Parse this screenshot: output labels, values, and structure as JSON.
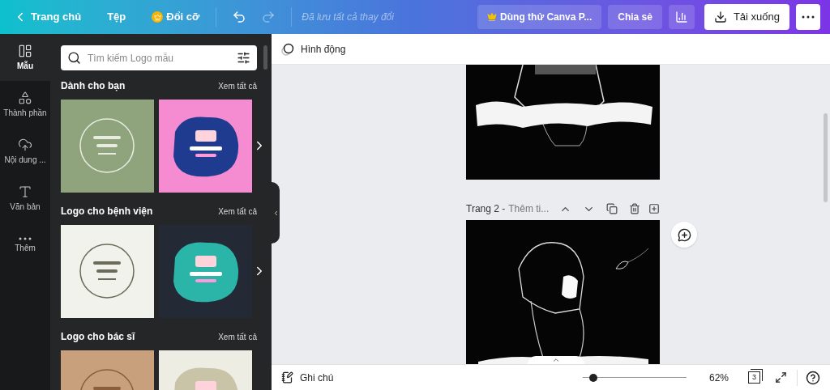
{
  "topbar": {
    "back": "Trang chủ",
    "file_menu": "Tệp",
    "resize": "Đổi cỡ",
    "save_status": "Đã lưu tất cả thay đổi",
    "try_pro": "Dùng thử Canva P...",
    "share": "Chia sẻ",
    "download": "Tải xuống"
  },
  "rail": [
    {
      "kind": "templates",
      "label": "Mẫu",
      "selected": true
    },
    {
      "kind": "elements",
      "label": "Thành phần",
      "selected": false
    },
    {
      "kind": "uploads",
      "label": "Nội dung ...",
      "selected": false
    },
    {
      "kind": "text",
      "label": "Văn bản",
      "selected": false
    },
    {
      "kind": "more",
      "label": "Thêm",
      "selected": false
    }
  ],
  "panel": {
    "search": {
      "placeholder": "Tìm kiếm Logo mẫu"
    },
    "sections": [
      {
        "title": "Dành cho bạn",
        "see_all": "Xem tất cả"
      },
      {
        "title": "Logo cho bệnh viện",
        "see_all": "Xem tất cả"
      },
      {
        "title": "Logo cho bác sĩ",
        "see_all": "Xem tất cả"
      }
    ]
  },
  "toolbar": {
    "animate": "Hình động"
  },
  "page_header": {
    "label": "Trang 2 -",
    "title_placeholder": "Thêm ti..."
  },
  "bottom": {
    "notes": "Ghi chú",
    "zoom": {
      "level": 0.1,
      "reading": "62%"
    },
    "page_count": "3"
  }
}
